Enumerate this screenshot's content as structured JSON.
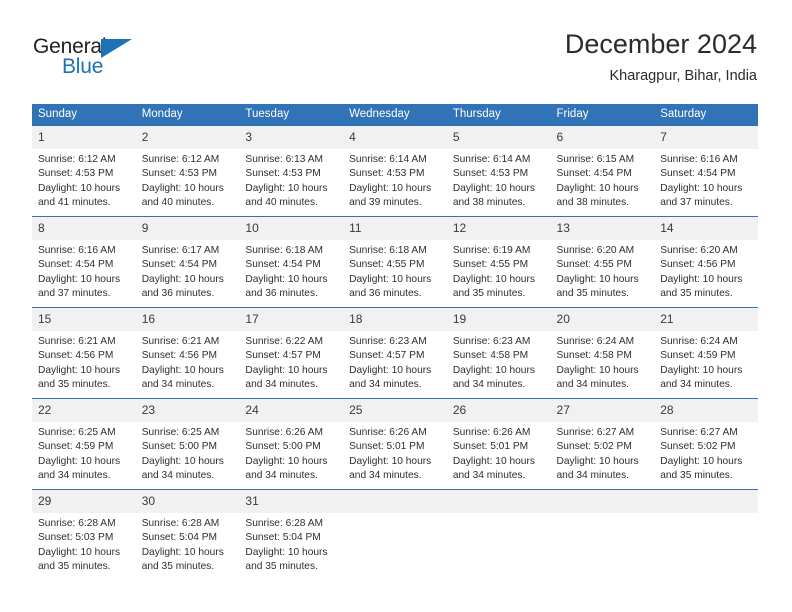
{
  "brand": {
    "name_part1": "General",
    "name_part2": "Blue",
    "triangle_icon": "triangle-icon",
    "accent_color": "#1b72b8"
  },
  "header": {
    "title": "December 2024",
    "location": "Kharagpur, Bihar, India"
  },
  "calendar": {
    "header_bg": "#3073b7",
    "daynum_bg": "#f1f1f1",
    "weekdays": [
      "Sunday",
      "Monday",
      "Tuesday",
      "Wednesday",
      "Thursday",
      "Friday",
      "Saturday"
    ],
    "weeks": [
      [
        {
          "day": "1",
          "sunrise": "Sunrise: 6:12 AM",
          "sunset": "Sunset: 4:53 PM",
          "daylight1": "Daylight: 10 hours",
          "daylight2": "and 41 minutes."
        },
        {
          "day": "2",
          "sunrise": "Sunrise: 6:12 AM",
          "sunset": "Sunset: 4:53 PM",
          "daylight1": "Daylight: 10 hours",
          "daylight2": "and 40 minutes."
        },
        {
          "day": "3",
          "sunrise": "Sunrise: 6:13 AM",
          "sunset": "Sunset: 4:53 PM",
          "daylight1": "Daylight: 10 hours",
          "daylight2": "and 40 minutes."
        },
        {
          "day": "4",
          "sunrise": "Sunrise: 6:14 AM",
          "sunset": "Sunset: 4:53 PM",
          "daylight1": "Daylight: 10 hours",
          "daylight2": "and 39 minutes."
        },
        {
          "day": "5",
          "sunrise": "Sunrise: 6:14 AM",
          "sunset": "Sunset: 4:53 PM",
          "daylight1": "Daylight: 10 hours",
          "daylight2": "and 38 minutes."
        },
        {
          "day": "6",
          "sunrise": "Sunrise: 6:15 AM",
          "sunset": "Sunset: 4:54 PM",
          "daylight1": "Daylight: 10 hours",
          "daylight2": "and 38 minutes."
        },
        {
          "day": "7",
          "sunrise": "Sunrise: 6:16 AM",
          "sunset": "Sunset: 4:54 PM",
          "daylight1": "Daylight: 10 hours",
          "daylight2": "and 37 minutes."
        }
      ],
      [
        {
          "day": "8",
          "sunrise": "Sunrise: 6:16 AM",
          "sunset": "Sunset: 4:54 PM",
          "daylight1": "Daylight: 10 hours",
          "daylight2": "and 37 minutes."
        },
        {
          "day": "9",
          "sunrise": "Sunrise: 6:17 AM",
          "sunset": "Sunset: 4:54 PM",
          "daylight1": "Daylight: 10 hours",
          "daylight2": "and 36 minutes."
        },
        {
          "day": "10",
          "sunrise": "Sunrise: 6:18 AM",
          "sunset": "Sunset: 4:54 PM",
          "daylight1": "Daylight: 10 hours",
          "daylight2": "and 36 minutes."
        },
        {
          "day": "11",
          "sunrise": "Sunrise: 6:18 AM",
          "sunset": "Sunset: 4:55 PM",
          "daylight1": "Daylight: 10 hours",
          "daylight2": "and 36 minutes."
        },
        {
          "day": "12",
          "sunrise": "Sunrise: 6:19 AM",
          "sunset": "Sunset: 4:55 PM",
          "daylight1": "Daylight: 10 hours",
          "daylight2": "and 35 minutes."
        },
        {
          "day": "13",
          "sunrise": "Sunrise: 6:20 AM",
          "sunset": "Sunset: 4:55 PM",
          "daylight1": "Daylight: 10 hours",
          "daylight2": "and 35 minutes."
        },
        {
          "day": "14",
          "sunrise": "Sunrise: 6:20 AM",
          "sunset": "Sunset: 4:56 PM",
          "daylight1": "Daylight: 10 hours",
          "daylight2": "and 35 minutes."
        }
      ],
      [
        {
          "day": "15",
          "sunrise": "Sunrise: 6:21 AM",
          "sunset": "Sunset: 4:56 PM",
          "daylight1": "Daylight: 10 hours",
          "daylight2": "and 35 minutes."
        },
        {
          "day": "16",
          "sunrise": "Sunrise: 6:21 AM",
          "sunset": "Sunset: 4:56 PM",
          "daylight1": "Daylight: 10 hours",
          "daylight2": "and 34 minutes."
        },
        {
          "day": "17",
          "sunrise": "Sunrise: 6:22 AM",
          "sunset": "Sunset: 4:57 PM",
          "daylight1": "Daylight: 10 hours",
          "daylight2": "and 34 minutes."
        },
        {
          "day": "18",
          "sunrise": "Sunrise: 6:23 AM",
          "sunset": "Sunset: 4:57 PM",
          "daylight1": "Daylight: 10 hours",
          "daylight2": "and 34 minutes."
        },
        {
          "day": "19",
          "sunrise": "Sunrise: 6:23 AM",
          "sunset": "Sunset: 4:58 PM",
          "daylight1": "Daylight: 10 hours",
          "daylight2": "and 34 minutes."
        },
        {
          "day": "20",
          "sunrise": "Sunrise: 6:24 AM",
          "sunset": "Sunset: 4:58 PM",
          "daylight1": "Daylight: 10 hours",
          "daylight2": "and 34 minutes."
        },
        {
          "day": "21",
          "sunrise": "Sunrise: 6:24 AM",
          "sunset": "Sunset: 4:59 PM",
          "daylight1": "Daylight: 10 hours",
          "daylight2": "and 34 minutes."
        }
      ],
      [
        {
          "day": "22",
          "sunrise": "Sunrise: 6:25 AM",
          "sunset": "Sunset: 4:59 PM",
          "daylight1": "Daylight: 10 hours",
          "daylight2": "and 34 minutes."
        },
        {
          "day": "23",
          "sunrise": "Sunrise: 6:25 AM",
          "sunset": "Sunset: 5:00 PM",
          "daylight1": "Daylight: 10 hours",
          "daylight2": "and 34 minutes."
        },
        {
          "day": "24",
          "sunrise": "Sunrise: 6:26 AM",
          "sunset": "Sunset: 5:00 PM",
          "daylight1": "Daylight: 10 hours",
          "daylight2": "and 34 minutes."
        },
        {
          "day": "25",
          "sunrise": "Sunrise: 6:26 AM",
          "sunset": "Sunset: 5:01 PM",
          "daylight1": "Daylight: 10 hours",
          "daylight2": "and 34 minutes."
        },
        {
          "day": "26",
          "sunrise": "Sunrise: 6:26 AM",
          "sunset": "Sunset: 5:01 PM",
          "daylight1": "Daylight: 10 hours",
          "daylight2": "and 34 minutes."
        },
        {
          "day": "27",
          "sunrise": "Sunrise: 6:27 AM",
          "sunset": "Sunset: 5:02 PM",
          "daylight1": "Daylight: 10 hours",
          "daylight2": "and 34 minutes."
        },
        {
          "day": "28",
          "sunrise": "Sunrise: 6:27 AM",
          "sunset": "Sunset: 5:02 PM",
          "daylight1": "Daylight: 10 hours",
          "daylight2": "and 35 minutes."
        }
      ],
      [
        {
          "day": "29",
          "sunrise": "Sunrise: 6:28 AM",
          "sunset": "Sunset: 5:03 PM",
          "daylight1": "Daylight: 10 hours",
          "daylight2": "and 35 minutes."
        },
        {
          "day": "30",
          "sunrise": "Sunrise: 6:28 AM",
          "sunset": "Sunset: 5:04 PM",
          "daylight1": "Daylight: 10 hours",
          "daylight2": "and 35 minutes."
        },
        {
          "day": "31",
          "sunrise": "Sunrise: 6:28 AM",
          "sunset": "Sunset: 5:04 PM",
          "daylight1": "Daylight: 10 hours",
          "daylight2": "and 35 minutes."
        },
        {
          "day": "",
          "sunrise": "",
          "sunset": "",
          "daylight1": "",
          "daylight2": ""
        },
        {
          "day": "",
          "sunrise": "",
          "sunset": "",
          "daylight1": "",
          "daylight2": ""
        },
        {
          "day": "",
          "sunrise": "",
          "sunset": "",
          "daylight1": "",
          "daylight2": ""
        },
        {
          "day": "",
          "sunrise": "",
          "sunset": "",
          "daylight1": "",
          "daylight2": ""
        }
      ]
    ]
  }
}
